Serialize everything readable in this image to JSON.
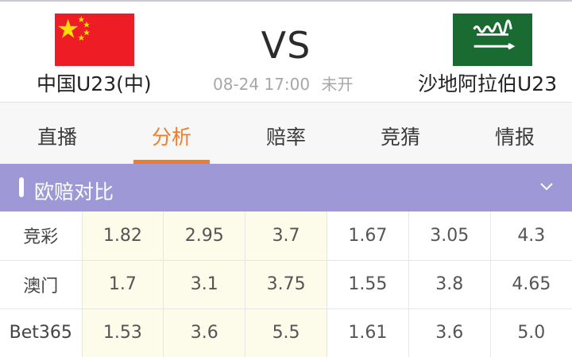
{
  "match": {
    "home_team": "中国U23(中)",
    "away_team": "沙地阿拉伯U23",
    "vs": "VS",
    "date_time": "08-24 17:00",
    "status": "未开"
  },
  "tabs": [
    {
      "label": "直播",
      "active": false
    },
    {
      "label": "分析",
      "active": true
    },
    {
      "label": "赔率",
      "active": false
    },
    {
      "label": "竞猜",
      "active": false
    },
    {
      "label": "情报",
      "active": false
    }
  ],
  "section": {
    "title": "欧赔对比"
  },
  "odds_rows": [
    {
      "company": "竞彩",
      "values": [
        "1.82",
        "2.95",
        "3.7",
        "1.67",
        "3.05",
        "4.3"
      ]
    },
    {
      "company": "澳门",
      "values": [
        "1.7",
        "3.1",
        "3.75",
        "1.55",
        "3.8",
        "4.65"
      ]
    },
    {
      "company": "Bet365",
      "values": [
        "1.53",
        "3.6",
        "5.5",
        "1.61",
        "3.6",
        "5.0"
      ]
    }
  ],
  "colors": {
    "accent": "#ef7d2c",
    "section_bar": "#9f98d6",
    "highlight_cell": "#fdfbea",
    "china_flag_red": "#ee1c25",
    "china_flag_star": "#ffde00",
    "saudi_flag_green": "#1a6b32"
  },
  "icons": {
    "home_flag": "china-flag-icon",
    "away_flag": "saudi-arabia-flag-icon",
    "expand": "chevron-down-icon"
  }
}
